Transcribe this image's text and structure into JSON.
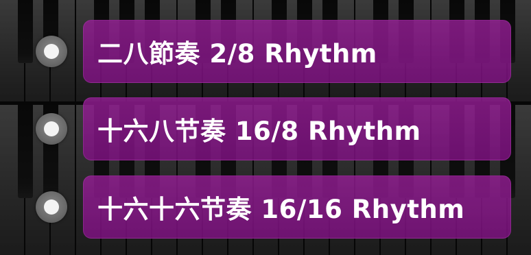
{
  "options": [
    {
      "label": "二八節奏 2/8 Rhythm",
      "selected": false
    },
    {
      "label": "十六八节奏 16/8 Rhythm",
      "selected": false
    },
    {
      "label": "十六十六节奏 16/16 Rhythm",
      "selected": false
    }
  ],
  "colors": {
    "option_background": "#8b1a8e",
    "radio_ring": "#7a7a7a",
    "radio_dot": "#f4f4f4",
    "label_text": "#ffffff"
  }
}
